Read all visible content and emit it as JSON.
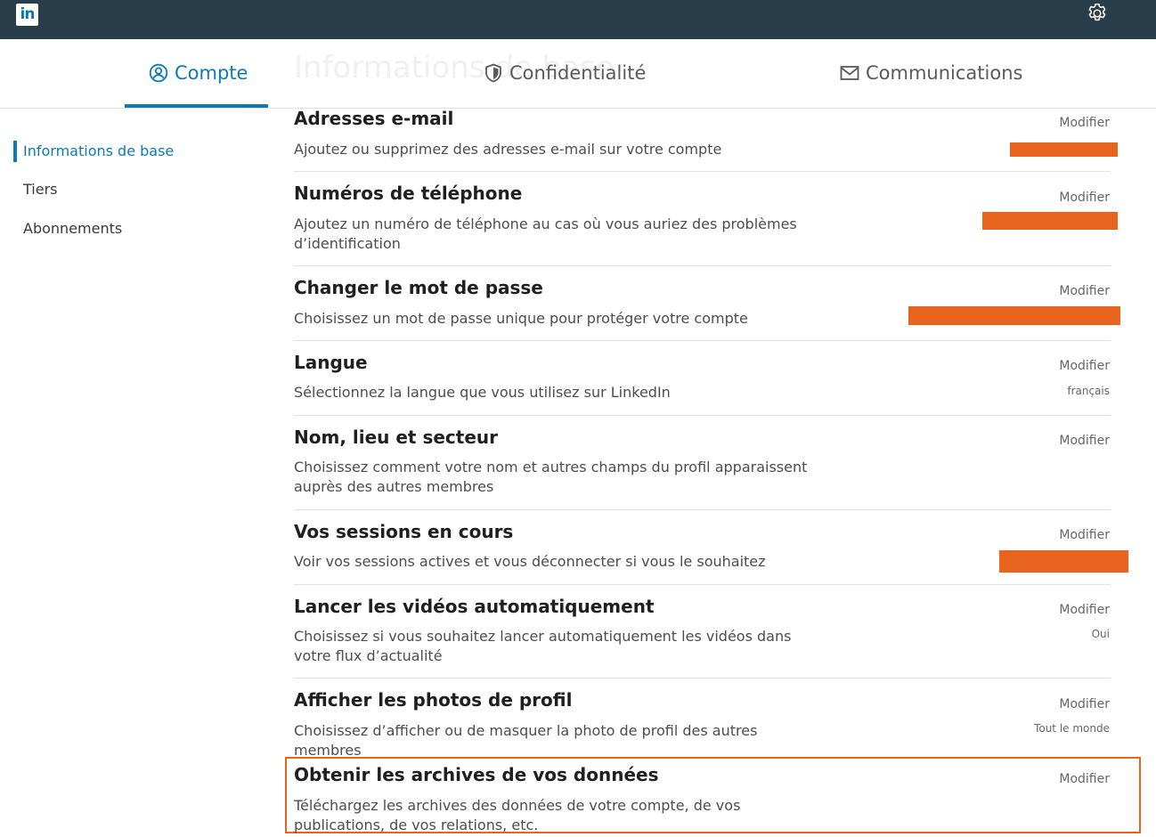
{
  "brand": {
    "logo_text": "in"
  },
  "header": {
    "ghost_title": "Informations de base"
  },
  "tabs": [
    {
      "label": "Compte",
      "icon": "account-icon",
      "active": true
    },
    {
      "label": "Confidentialité",
      "icon": "shield-icon",
      "active": false
    },
    {
      "label": "Communications",
      "icon": "envelope-icon",
      "active": false
    }
  ],
  "sidebar": {
    "items": [
      {
        "label": "Informations de base",
        "active": true
      },
      {
        "label": "Tiers",
        "active": false
      },
      {
        "label": "Abonnements",
        "active": false
      }
    ]
  },
  "settings": [
    {
      "title": "Adresses e-mail",
      "description": "Ajoutez ou supprimez des adresses e-mail sur votre compte",
      "action": "Modifier",
      "value": "",
      "redacted": true
    },
    {
      "title": "Numéros de téléphone",
      "description": "Ajoutez un numéro de téléphone au cas où vous auriez des problèmes d’identification",
      "action": "Modifier",
      "value": "",
      "redacted": true
    },
    {
      "title": "Changer le mot de passe",
      "description": "Choisissez un mot de passe unique pour protéger votre compte",
      "action": "Modifier",
      "value": "",
      "redacted": true
    },
    {
      "title": "Langue",
      "description": "Sélectionnez la langue que vous utilisez sur LinkedIn",
      "action": "Modifier",
      "value": "français",
      "redacted": false
    },
    {
      "title": "Nom, lieu et secteur",
      "description": "Choisissez comment votre nom et autres champs du profil apparaissent auprès des autres membres",
      "action": "Modifier",
      "value": "",
      "redacted": false
    },
    {
      "title": "Vos sessions en cours",
      "description": "Voir vos sessions actives et vous déconnecter si vous le souhaitez",
      "action": "Modifier",
      "value": "",
      "redacted": true
    },
    {
      "title": "Lancer les vidéos automatiquement",
      "description": "Choisissez si vous souhaitez lancer automatiquement les vidéos dans votre flux d’actualité",
      "action": "Modifier",
      "value": "Oui",
      "redacted": false
    },
    {
      "title": "Afficher les photos de profil",
      "description": "Choisissez d’afficher ou de masquer la photo de profil des autres membres",
      "action": "Modifier",
      "value": "Tout le monde",
      "redacted": false
    },
    {
      "title": "Obtenir les archives de vos données",
      "description": "Téléchargez les archives des données de votre compte, de vos publications, de vos relations, etc.",
      "action": "Modifier",
      "value": "",
      "redacted": false,
      "highlighted": true
    }
  ],
  "colors": {
    "topbar": "#283e4a",
    "accent": "#0e7ab5",
    "highlight": "#e8631e",
    "redaction": "#e8631e"
  }
}
